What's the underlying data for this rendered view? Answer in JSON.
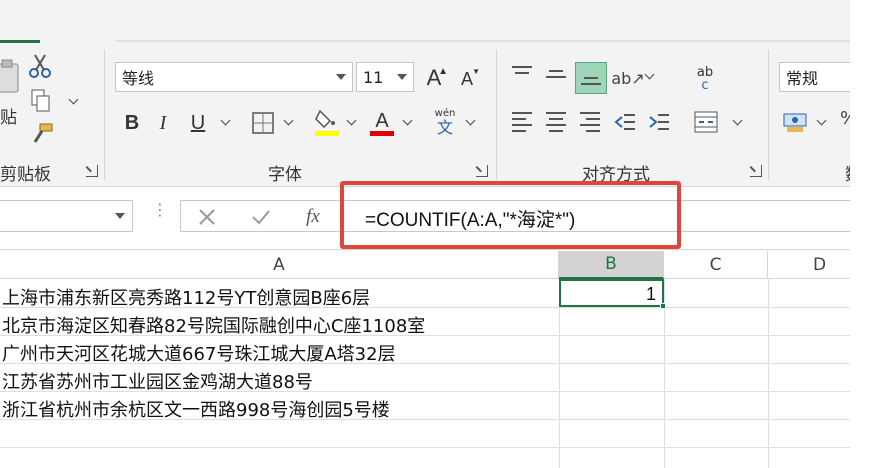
{
  "ribbon": {
    "clipboard_label": "剪贴板",
    "paste_label_partial": "贴",
    "font_group_label": "字体",
    "align_group_label": "对齐方式",
    "number_group_label_partial": "数",
    "font_name": "等线",
    "font_size": "11",
    "grow_font_glyph": "A",
    "shrink_font_glyph": "A",
    "bold_glyph": "B",
    "italic_glyph": "I",
    "underline_glyph": "U",
    "phonetic_top": "wén",
    "phonetic_bottom": "文",
    "wrap_glyph_top": "ab",
    "wrap_glyph_bottom": "c",
    "number_format": "常规",
    "percent_partial": "%",
    "highlight_color": "#ffff00",
    "font_color": "#e00000"
  },
  "formula_bar": {
    "fx_label": "fx",
    "formula": "=COUNTIF(A:A,\"*海淀*\")",
    "highlight_color": "#e0453c"
  },
  "grid": {
    "columns": [
      "A",
      "B",
      "C",
      "D"
    ],
    "selected_column": "B",
    "rows": [
      {
        "a": "上海市浦东新区亮秀路112号YT创意园B座6层",
        "b": "1"
      },
      {
        "a": "北京市海淀区知春路82号院国际融创中心C座1108室",
        "b": ""
      },
      {
        "a": "广州市天河区花城大道667号珠江城大厦A塔32层",
        "b": ""
      },
      {
        "a": "江苏省苏州市工业园区金鸡湖大道88号",
        "b": ""
      },
      {
        "a": "浙江省杭州市余杭区文一西路998号海创园5号楼",
        "b": ""
      }
    ],
    "accent": "#217346"
  }
}
